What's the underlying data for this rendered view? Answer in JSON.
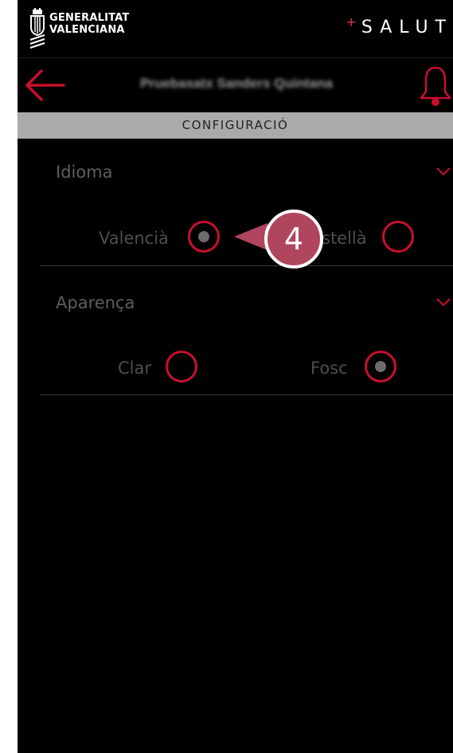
{
  "brand": {
    "org_line1": "GENERALITAT",
    "org_line2": "VALENCIANA",
    "app_plus": "+",
    "app_name": "SALUT",
    "accent_color": "#c8102e",
    "logo_icon": "gva-coat-of-arms-icon"
  },
  "header": {
    "back_icon": "arrow-left-icon",
    "user_name": "Pruebasatx Sanders Quintana",
    "bell_icon": "bell-icon"
  },
  "section": {
    "title": "CONFIGURACIÓ"
  },
  "groups": [
    {
      "title": "Idioma",
      "expand_icon": "chevron-down-icon",
      "options": [
        {
          "label": "Valencià",
          "selected": true
        },
        {
          "label": "stellà",
          "selected": false
        }
      ]
    },
    {
      "title": "Aparença",
      "expand_icon": "chevron-down-icon",
      "options": [
        {
          "label": "Clar",
          "selected": false
        },
        {
          "label": "Fosc",
          "selected": true
        }
      ]
    }
  ],
  "annotation": {
    "step": "4",
    "color": "#b0455e"
  }
}
